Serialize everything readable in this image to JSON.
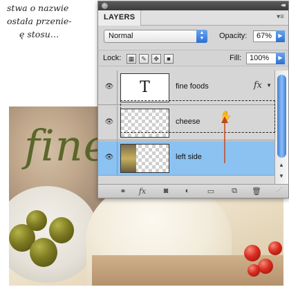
{
  "book_text": {
    "line1": "stwa o nazwie",
    "line2": "ostała przenie-",
    "line3": "ę stosu…"
  },
  "photo": {
    "script_text": "fine"
  },
  "panel": {
    "tab_label": "LAYERS",
    "blend_mode": "Normal",
    "opacity_label": "Opacity:",
    "opacity_value": "67%",
    "lock_label": "Lock:",
    "fill_label": "Fill:",
    "fill_value": "100%",
    "layers": [
      {
        "name": "fine foods",
        "thumb_text": "T",
        "fx": "fx",
        "selected": false
      },
      {
        "name": "cheese",
        "selected": false
      },
      {
        "name": "left side",
        "selected": true
      }
    ],
    "bottom_fx": "fx"
  },
  "colors": {
    "selection": "#8bc2f2",
    "accent": "#2d6fd1",
    "drag_arrow": "#c2471c"
  }
}
